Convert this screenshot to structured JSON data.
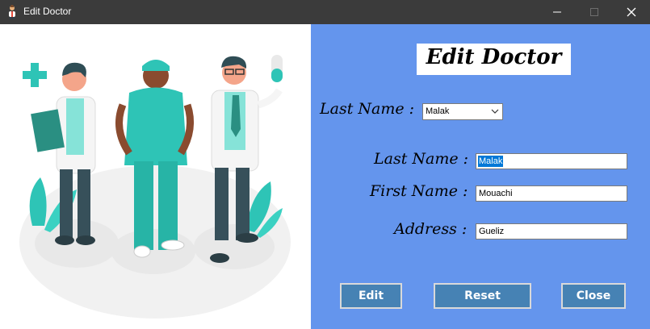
{
  "window": {
    "title": "Edit Doctor",
    "titlebar_color": "#3b3b3b",
    "controls": {
      "minimize": "minimize-icon",
      "maximize": "maximize-icon",
      "close": "close-icon"
    }
  },
  "illustration": {
    "description_icon": "doctors-illustration"
  },
  "panel": {
    "background": "#6495ed"
  },
  "heading": "Edit Doctor",
  "selector": {
    "label": "Last Name :",
    "selected": "Malak"
  },
  "form": {
    "last_name_label": "Last Name :",
    "last_name_value": "Malak",
    "first_name_label": "First Name :",
    "first_name_value": "Mouachi",
    "address_label": "Address :",
    "address_value": "Gueliz"
  },
  "buttons": {
    "edit": "Edit",
    "reset": "Reset",
    "close": "Close"
  },
  "colors": {
    "button_bg": "#4682b4",
    "accent_teal": "#2ec4b6"
  }
}
